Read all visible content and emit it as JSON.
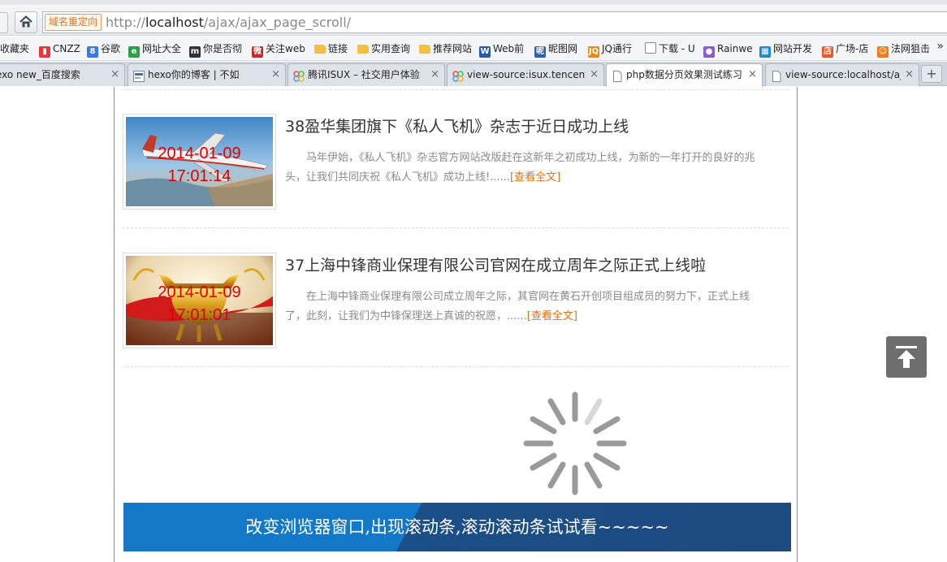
{
  "browser": {
    "url_badge": "域名重定向",
    "url_scheme": "http://",
    "url_host": "localhost",
    "url_path": "/ajax/ajax_page_scroll/",
    "bookmarks": [
      {
        "label": "收藏夹",
        "icon": "star-folder-icon",
        "color": "#f2b01e"
      },
      {
        "label": "CNZZ",
        "icon": "chart-icon",
        "color": "#e5383b"
      },
      {
        "label": "谷歌",
        "icon": "google-icon",
        "color": "#3b78e7"
      },
      {
        "label": "网址大全",
        "icon": "browser-logo-icon",
        "color": "#2aa145"
      },
      {
        "label": "你是否彻",
        "icon": "m-logo-icon",
        "color": "#333333"
      },
      {
        "label": "关注web",
        "icon": "weibo-icon",
        "color": "#c9282d"
      },
      {
        "label": "链接",
        "icon": "folder-icon",
        "color": "#f0c040"
      },
      {
        "label": "实用查询",
        "icon": "folder-icon",
        "color": "#f0c040"
      },
      {
        "label": "推荐网站",
        "icon": "folder-icon",
        "color": "#f0c040"
      },
      {
        "label": "Web前",
        "icon": "w-logo-icon",
        "color": "#2a5aa8"
      },
      {
        "label": "昵图网",
        "icon": "nipic-icon",
        "color": "#3060b0"
      },
      {
        "label": "JQ通行",
        "icon": "jq-icon",
        "color": "#e88a1a"
      },
      {
        "label": "下载 - U",
        "icon": "page-icon",
        "color": "#888888"
      },
      {
        "label": "Rainwe",
        "icon": "apple-icon",
        "color": "#8a5cd0"
      },
      {
        "label": "网站开发",
        "icon": "grid-icon",
        "color": "#1d8ad8"
      },
      {
        "label": "广场-店",
        "icon": "shop-icon",
        "color": "#e8562a"
      },
      {
        "label": "法网狙击",
        "icon": "smile-icon",
        "color": "#f07a1a"
      }
    ],
    "bookmarks_more": "»",
    "tabs": [
      {
        "title": "exo new_百度搜索",
        "active": false,
        "icon": "paw-icon"
      },
      {
        "title": "hexo你的博客 | 不如",
        "active": false,
        "icon": "site-icon"
      },
      {
        "title": "腾讯ISUX – 社交用户体验",
        "active": false,
        "icon": "isux-icon"
      },
      {
        "title": "view-source:isux.tencent",
        "active": false,
        "icon": "isux-icon"
      },
      {
        "title": "php数据分页效果测试练习",
        "active": true,
        "icon": "page-icon"
      },
      {
        "title": "view-source:localhost/aj",
        "active": false,
        "icon": "page-icon"
      }
    ],
    "tab_close": "×",
    "new_tab": "+"
  },
  "articles": [
    {
      "title": "38盈华集团旗下《私人飞机》杂志于近日成功上线",
      "body": "马年伊始，《私人飞机》杂志官方网站改版赶在这新年之初成功上线，为新的一年打开的良好的兆头，让我们共同庆祝《私人飞机》成功上线!......",
      "more": "[查看全文]",
      "date_line1": "2014-01-09",
      "date_line2": "17:01:14",
      "image": "airplane-photo"
    },
    {
      "title": "37上海中锋商业保理有限公司官网在成立周年之际正式上线啦",
      "body": "在上海中锋商业保理有限公司成立周年之际，其官网在黄石开创项目组成员的努力下，正式上线了，此刻，让我们为中锋保理送上真诚的祝愿，......",
      "more": "[查看全文]",
      "date_line1": "2014-01-09",
      "date_line2": "17:01:01",
      "image": "golden-cauldron-photo"
    }
  ],
  "loader": {
    "icon": "loading-spinner-icon"
  },
  "banner": {
    "text": "改变浏览器窗口,出现滚动条,滚动滚动条试试看~~~~~"
  },
  "back_to_top": {
    "icon": "back-to-top-icon"
  }
}
